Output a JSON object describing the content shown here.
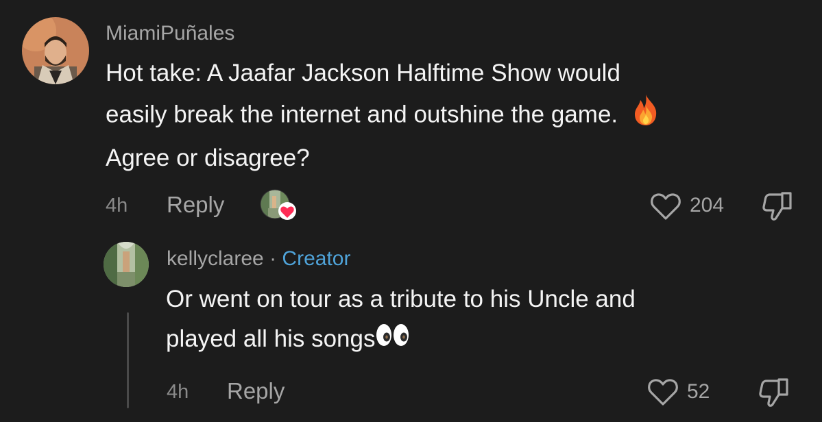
{
  "comment": {
    "username": "MiamiPuñales",
    "text_lines": [
      "Hot take: A Jaafar Jackson Halftime Show would",
      "easily break the internet and outshine the game.",
      "Agree or disagree?"
    ],
    "emoji_icon": "fire-emoji-icon",
    "time": "4h",
    "reply_label": "Reply",
    "like_count": "204"
  },
  "reply": {
    "username": "kellyclaree",
    "separator": "·",
    "badge": "Creator",
    "text_lines": [
      "Or went on tour as a tribute to his Uncle and",
      "played all his songs"
    ],
    "emoji_icon": "eyes-emoji-icon",
    "time": "4h",
    "reply_label": "Reply",
    "like_count": "52"
  },
  "colors": {
    "background": "#1c1c1c",
    "text": "#f4f4f4",
    "muted": "#a6a6a6",
    "creator": "#4fa3d9",
    "heart_badge": "#fe2c55"
  }
}
